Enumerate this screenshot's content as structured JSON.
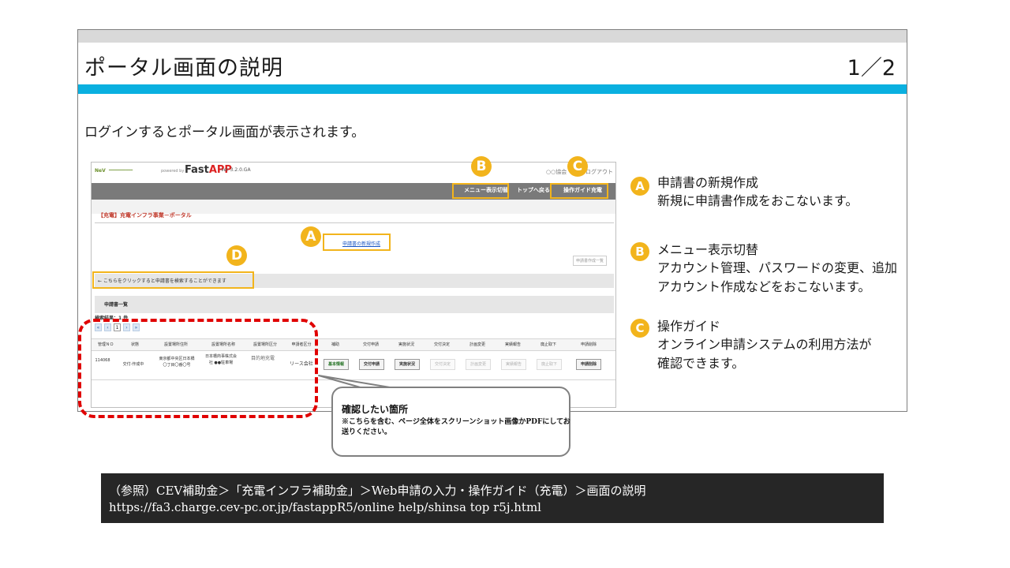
{
  "slide": {
    "title": "ポータル画面の説明",
    "page": "1／2",
    "intro": "ログインするとポータル画面が表示されます。"
  },
  "portal": {
    "logo": "NeV",
    "powered_by": "powered by",
    "fastapp_fast": "Fast",
    "fastapp_app": "APP",
    "version": "ver 3.2.0.GA",
    "user_label": "○○協会",
    "logout": "ログアウト",
    "nav": {
      "menu_toggle": "メニュー表示切替",
      "top": "トップへ戻る",
      "guide": "操作ガイド充電"
    },
    "portal_title": "【充電】充電インフラ事業－ポータル",
    "new_application": "申請書の新規作成",
    "list_button": "申請書作成一覧",
    "hint": "← こちらをクリックすると申請書を検索することができます",
    "section_title": "申請書一覧",
    "result_count": "検索結果：1 件",
    "pager": [
      "«",
      "‹",
      "1",
      "›",
      "»"
    ],
    "columns": [
      "管理ＮＯ",
      "状態",
      "設置場所住所",
      "設置場所名称",
      "設置場所区分",
      "申請者区分",
      "補助",
      "交付申請",
      "実施状況",
      "交付決定",
      "計画変更",
      "実績報告",
      "廃止取下",
      "申請削除"
    ],
    "row": {
      "id": "114068",
      "status": "交付-作成中",
      "address": "東京都中央区日本橋〇丁目〇番〇号",
      "place_name": "日本橋商事株式会社 ●●駐車場",
      "place_type": "目的地充電",
      "applicant_type": "リース会社",
      "buttons": [
        "基本情報",
        "交付申請",
        "実施状況",
        "交付決定",
        "計画変更",
        "実績報告",
        "廃止取下",
        "申請削除"
      ]
    }
  },
  "markers": [
    "A",
    "B",
    "C",
    "D"
  ],
  "legend": [
    {
      "badge": "A",
      "title": "申請書の新規作成",
      "desc": [
        "新規に申請書作成をおこないます。"
      ]
    },
    {
      "badge": "B",
      "title": "メニュー表示切替",
      "desc": [
        "アカウント管理、パスワードの変更、追加",
        "アカウント作成などをおこないます。"
      ]
    },
    {
      "badge": "C",
      "title": "操作ガイド",
      "desc": [
        "オンライン申請システムの利用方法が",
        "確認できます。"
      ]
    }
  ],
  "callout": {
    "title": "確認したい箇所",
    "note": "※こちらを含む、ページ全体をスクリーンショット画像かPDFにしてお送りください。"
  },
  "reference": {
    "line1": "（参照）CEV補助金＞「充電インフラ補助金」＞Web申請の入力・操作ガイド（充電）＞画面の説明",
    "line2": "https://fa3.charge.cev-pc.or.jp/fastappR5/online help/shinsa top r5j.html"
  },
  "colors": {
    "accent_cyan": "#0ab0e0",
    "marker_yellow": "#f2b41c",
    "dash_red": "#e00000",
    "ref_bg": "#262626"
  }
}
